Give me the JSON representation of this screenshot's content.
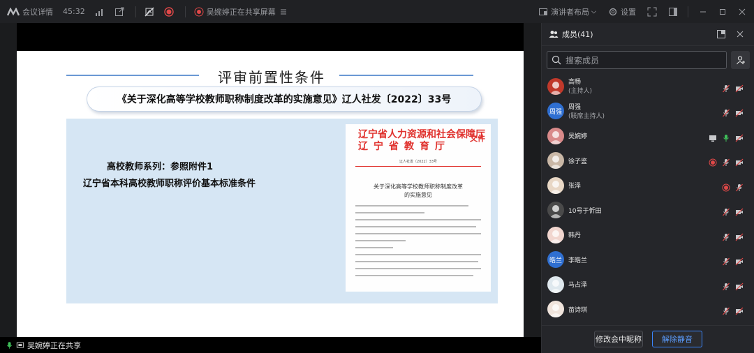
{
  "topbar": {
    "meeting_details": "会议详情",
    "timer": "45:32",
    "sharing_notice": "吴婉婷正在共享屏幕",
    "presenter_layout": "演讲者布局",
    "settings": "设置"
  },
  "slide": {
    "title": "评审前置性条件",
    "banner": "《关于深化高等学校教师职称制度改革的实施意见》辽人社发〔2022〕33号",
    "line1": "高校教师系列：参照附件1",
    "line2": "辽宁省本科高校教师职称评价基本标准条件",
    "document": {
      "header1": "辽宁省人力资源和社会保障厅",
      "header2": "辽宁省教育厅",
      "file_word": "文件",
      "doc_number": "辽人社发〔2022〕33号",
      "title1": "关于深化高等学校教师职称制度改革",
      "title2": "的实施意见"
    }
  },
  "share_bar": {
    "text": "吴婉婷正在共享"
  },
  "members_panel": {
    "title": "成员(41)",
    "search_placeholder": "搜索成员",
    "members": [
      {
        "name": "高畅",
        "role": "(主持人)",
        "avatar_color": "#c0392b"
      },
      {
        "name": "周强",
        "role": "(联席主持人)",
        "avatar_text": "周强",
        "avatar_color": "#2f6fd1"
      },
      {
        "name": "吴婉婷",
        "role": "",
        "avatar_color": "#d98a8a"
      },
      {
        "name": "徐子鉴",
        "role": "",
        "avatar_color": "#c9b7a6"
      },
      {
        "name": "张泽",
        "role": "",
        "avatar_color": "#e8d7c5"
      },
      {
        "name": "10号于忻田",
        "role": "",
        "avatar_color": "#4a4a4a"
      },
      {
        "name": "韩丹",
        "role": "",
        "avatar_color": "#f1d6cf"
      },
      {
        "name": "李皓兰",
        "role": "",
        "avatar_text": "皓兰",
        "avatar_color": "#2f6fd1"
      },
      {
        "name": "马占泽",
        "role": "",
        "avatar_color": "#dfe8ee"
      },
      {
        "name": "苗诗琪",
        "role": "",
        "avatar_color": "#f0e4dc"
      }
    ],
    "rename_button": "修改会中昵称",
    "unmute_button": "解除静音"
  },
  "colors": {
    "accent": "#3a86ff",
    "mute_red": "#e04848",
    "record_red": "#e0322e"
  }
}
